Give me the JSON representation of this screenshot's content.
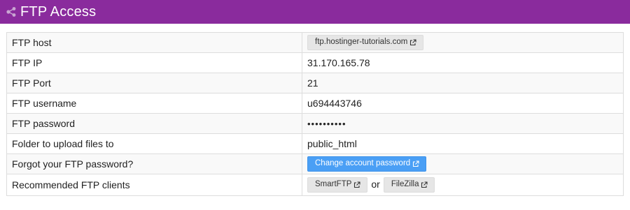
{
  "header": {
    "title": "FTP Access",
    "icon": "share-nodes-icon",
    "color": "#8a2b9d"
  },
  "rows": [
    {
      "label": "FTP host",
      "button": "ftp.hostinger-tutorials.com"
    },
    {
      "label": "FTP IP",
      "value": "31.170.165.78"
    },
    {
      "label": "FTP Port",
      "value": "21"
    },
    {
      "label": "FTP username",
      "value": "u694443746"
    },
    {
      "label": "FTP password",
      "value": "••••••••••"
    },
    {
      "label": "Folder to upload files to",
      "value": "public_html"
    },
    {
      "label": "Forgot your FTP password?",
      "button": "Change account password"
    },
    {
      "label": "Recommended FTP clients",
      "buttons": [
        "SmartFTP",
        "FileZilla"
      ],
      "separator": "or"
    }
  ],
  "colors": {
    "primary_button": "#4a9ff5",
    "default_button": "#e6e6e6"
  }
}
